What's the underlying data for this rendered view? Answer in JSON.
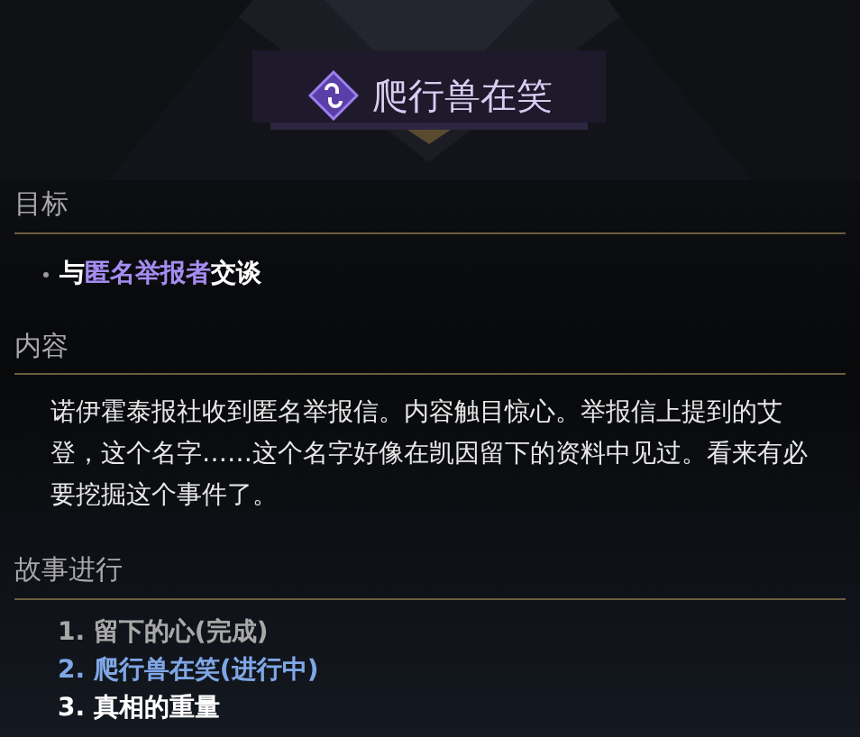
{
  "title": "爬行兽在笑",
  "objective": {
    "heading": "目标",
    "items": [
      {
        "segments": [
          {
            "text": "与",
            "highlight": false
          },
          {
            "text": "匿名举报者",
            "highlight": true
          },
          {
            "text": "交谈",
            "highlight": false
          }
        ]
      }
    ]
  },
  "content": {
    "heading": "内容",
    "text": "诺伊霍泰报社收到匿名举报信。内容触目惊心。举报信上提到的艾登，这个名字……这个名字好像在凯因留下的资料中见过。看来有必要挖掘这个事件了。"
  },
  "story": {
    "heading": "故事进行",
    "items": [
      {
        "label": "1. 留下的心(完成)",
        "completed": true,
        "current": false
      },
      {
        "label": "2. 爬行兽在笑(进行中)",
        "completed": false,
        "current": true
      },
      {
        "label": "3. 真相的重量",
        "completed": false,
        "current": false
      }
    ]
  }
}
